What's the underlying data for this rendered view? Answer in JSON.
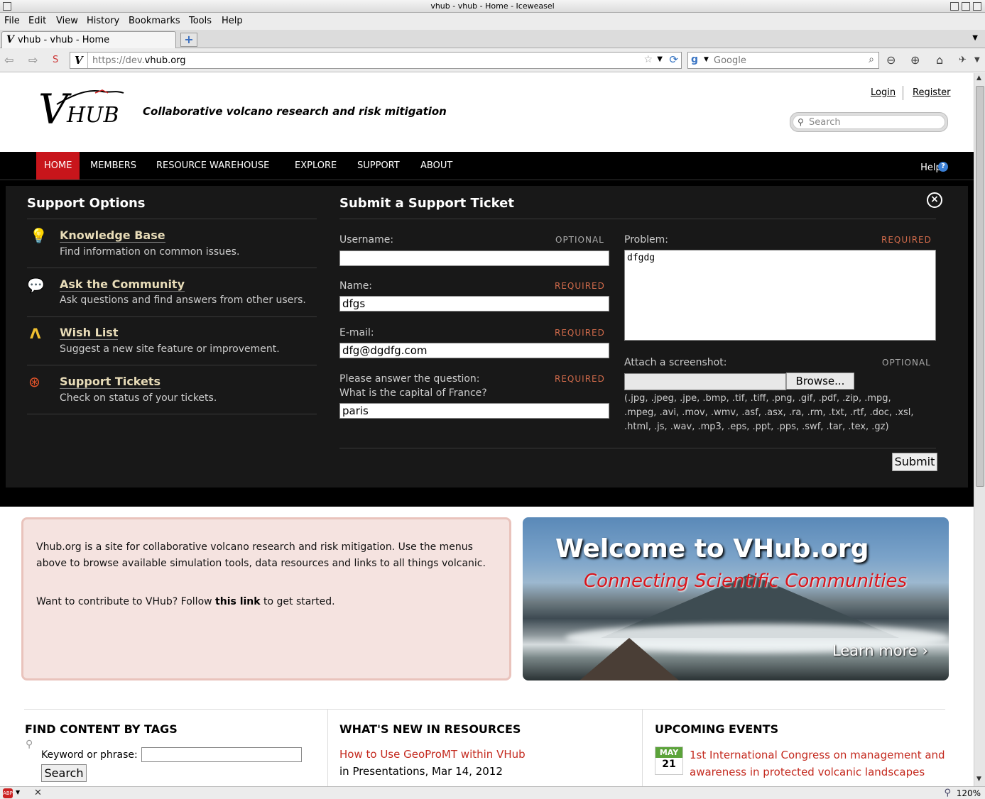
{
  "window": {
    "title": "vhub - vhub - Home - Iceweasel"
  },
  "menu": [
    "File",
    "Edit",
    "View",
    "History",
    "Bookmarks",
    "Tools",
    "Help"
  ],
  "tab": {
    "favicon": "V",
    "label": "vhub - vhub - Home"
  },
  "navbar": {
    "url_prefix": "https://dev.",
    "url_domain": "vhub.org",
    "search_placeholder": "Google"
  },
  "header": {
    "logo_v": "V",
    "logo_hub": "HUB",
    "tagline": "Collaborative volcano research and risk mitigation",
    "login": "Login",
    "register": "Register",
    "search_placeholder": "Search"
  },
  "mainnav": {
    "items": [
      "HOME",
      "MEMBERS",
      "RESOURCE WAREHOUSE",
      "EXPLORE",
      "SUPPORT",
      "ABOUT"
    ],
    "help": "Help!",
    "help_icon": "?"
  },
  "support": {
    "options_title": "Support Options",
    "options": [
      {
        "icon": "lightbulb-icon",
        "title": "Knowledge Base",
        "desc": "Find information on common issues."
      },
      {
        "icon": "chat-bubbles-icon",
        "title": "Ask the Community",
        "desc": "Ask questions and find answers from other users."
      },
      {
        "icon": "wishbone-icon",
        "title": "Wish List",
        "desc": "Suggest a new site feature or improvement."
      },
      {
        "icon": "lifebuoy-icon",
        "title": "Support Tickets",
        "desc": "Check on status of your tickets."
      }
    ],
    "ticket_title": "Submit a Support Ticket",
    "fields": {
      "username": {
        "label": "Username:",
        "tag": "OPTIONAL",
        "value": ""
      },
      "name": {
        "label": "Name:",
        "tag": "REQUIRED",
        "value": "dfgs"
      },
      "email": {
        "label": "E-mail:",
        "tag": "REQUIRED",
        "value": "dfg@dgdfg.com"
      },
      "question": {
        "label": "Please answer the question:",
        "sub": "What is the capital of France?",
        "tag": "REQUIRED",
        "value": "paris"
      },
      "problem": {
        "label": "Problem:",
        "tag": "REQUIRED",
        "value": "dfgdg"
      },
      "screenshot": {
        "label": "Attach a screenshot:",
        "tag": "OPTIONAL",
        "browse": "Browse..."
      }
    },
    "extensions": "(.jpg, .jpeg, .jpe, .bmp, .tif, .tiff, .png, .gif, .pdf, .zip, .mpg, .mpeg, .avi, .mov, .wmv, .asf, .asx, .ra, .rm, .txt, .rtf, .doc, .xsl, .html, .js, .wav, .mp3, .eps, .ppt, .pps, .swf, .tar, .tex, .gz)",
    "submit": "Submit"
  },
  "info": {
    "p1": "Vhub.org is a site for collaborative volcano research and risk mitigation. Use the menus above to browse available simulation tools, data resources and links to all things volcanic.",
    "p2_pre": "Want to contribute to VHub? Follow ",
    "p2_link": "this link",
    "p2_post": " to get started."
  },
  "banner": {
    "title": "Welcome to VHub.org",
    "subtitle": "Connecting Scientific Communities",
    "cta": "Learn more ›"
  },
  "tags": {
    "title": "FIND CONTENT BY TAGS",
    "label": "Keyword or phrase:",
    "button": "Search"
  },
  "resources": {
    "title": "WHAT'S NEW IN RESOURCES",
    "link": "How to Use GeoProMT within VHub",
    "meta": "in Presentations, Mar 14, 2012"
  },
  "events": {
    "title": "UPCOMING EVENTS",
    "month": "MAY",
    "day": "21",
    "link": "1st International Congress on management and awareness in protected volcanic landscapes"
  },
  "status": {
    "zoom": "120%",
    "abp": "ABP"
  }
}
